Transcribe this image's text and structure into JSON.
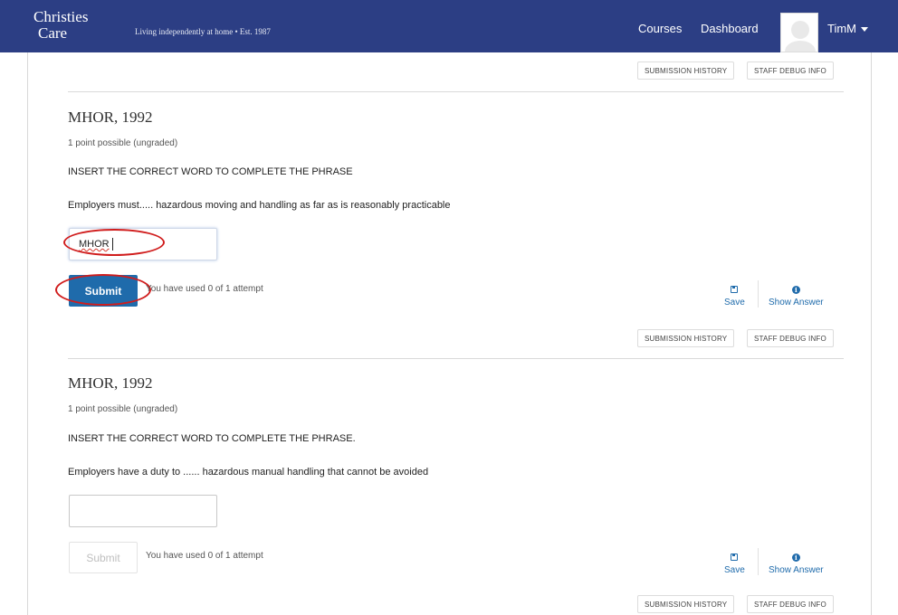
{
  "header": {
    "logo_line1": "Christies",
    "logo_line2": "Care",
    "tagline": "Living independently at home • Est. 1987",
    "nav": {
      "courses": "Courses",
      "dashboard": "Dashboard"
    },
    "username": "TimM"
  },
  "toolbar_top": {
    "submission_history": "SUBMISSION HISTORY",
    "staff_debug_info": "STAFF DEBUG INFO"
  },
  "problems": [
    {
      "title": "MHOR, 1992",
      "points": "1 point possible (ungraded)",
      "instruction": "INSERT THE CORRECT WORD TO COMPLETE THE PHRASE",
      "text": "Employers must..... hazardous moving and handling as far as is reasonably practicable",
      "answer_value": "MHOR",
      "submit_label": "Submit",
      "attempts": "You have used 0 of 1 attempt",
      "save_label": "Save",
      "show_answer_label": "Show Answer",
      "submission_history": "SUBMISSION HISTORY",
      "staff_debug_info": "STAFF DEBUG INFO"
    },
    {
      "title": "MHOR, 1992",
      "points": "1 point possible (ungraded)",
      "instruction": "INSERT THE CORRECT WORD TO COMPLETE THE PHRASE.",
      "text": "Employers have a duty to ...... hazardous manual handling that cannot be avoided",
      "answer_value": "",
      "submit_label": "Submit",
      "attempts": "You have used 0 of 1 attempt",
      "save_label": "Save",
      "show_answer_label": "Show Answer",
      "submission_history": "SUBMISSION HISTORY",
      "staff_debug_info": "STAFF DEBUG INFO"
    }
  ],
  "colors": {
    "header_bg": "#2c3e84",
    "primary": "#1f6bab",
    "annotation": "#d01d1d"
  },
  "icons": [
    "save-icon",
    "info-icon",
    "chevron-down-icon",
    "avatar"
  ]
}
